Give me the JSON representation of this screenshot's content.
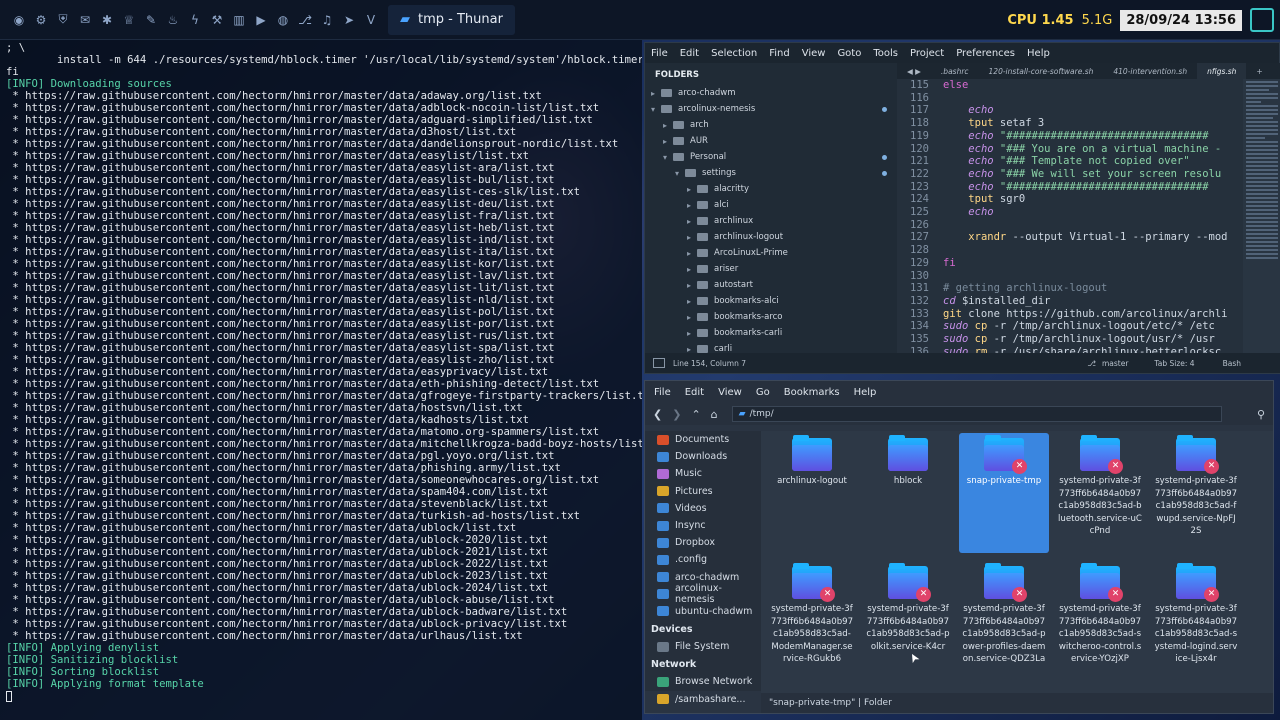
{
  "panel": {
    "window_title": "tmp - Thunar",
    "cpu": "CPU 1.45",
    "mem": "5.1G",
    "datetime": "28/09/24 13:56"
  },
  "terminal": {
    "lines": [
      {
        "t": "; \\",
        "c": ""
      },
      {
        "t": "        install -m 644 ./resources/systemd/hblock.timer '/usr/local/lib/systemd/system'/hblock.timer; \\",
        "c": ""
      },
      {
        "t": "fi",
        "c": ""
      },
      {
        "t": "[INFO] Downloading sources",
        "c": "info"
      },
      {
        "t": " * https://raw.githubusercontent.com/hectorm/hmirror/master/data/adaway.org/list.txt",
        "c": "url"
      },
      {
        "t": " * https://raw.githubusercontent.com/hectorm/hmirror/master/data/adblock-nocoin-list/list.txt",
        "c": "url"
      },
      {
        "t": " * https://raw.githubusercontent.com/hectorm/hmirror/master/data/adguard-simplified/list.txt",
        "c": "url"
      },
      {
        "t": " * https://raw.githubusercontent.com/hectorm/hmirror/master/data/d3host/list.txt",
        "c": "url"
      },
      {
        "t": " * https://raw.githubusercontent.com/hectorm/hmirror/master/data/dandelionsprout-nordic/list.txt",
        "c": "url"
      },
      {
        "t": " * https://raw.githubusercontent.com/hectorm/hmirror/master/data/easylist/list.txt",
        "c": "url"
      },
      {
        "t": " * https://raw.githubusercontent.com/hectorm/hmirror/master/data/easylist-ara/list.txt",
        "c": "url"
      },
      {
        "t": " * https://raw.githubusercontent.com/hectorm/hmirror/master/data/easylist-bul/list.txt",
        "c": "url"
      },
      {
        "t": " * https://raw.githubusercontent.com/hectorm/hmirror/master/data/easylist-ces-slk/list.txt",
        "c": "url"
      },
      {
        "t": " * https://raw.githubusercontent.com/hectorm/hmirror/master/data/easylist-deu/list.txt",
        "c": "url"
      },
      {
        "t": " * https://raw.githubusercontent.com/hectorm/hmirror/master/data/easylist-fra/list.txt",
        "c": "url"
      },
      {
        "t": " * https://raw.githubusercontent.com/hectorm/hmirror/master/data/easylist-heb/list.txt",
        "c": "url"
      },
      {
        "t": " * https://raw.githubusercontent.com/hectorm/hmirror/master/data/easylist-ind/list.txt",
        "c": "url"
      },
      {
        "t": " * https://raw.githubusercontent.com/hectorm/hmirror/master/data/easylist-ita/list.txt",
        "c": "url"
      },
      {
        "t": " * https://raw.githubusercontent.com/hectorm/hmirror/master/data/easylist-kor/list.txt",
        "c": "url"
      },
      {
        "t": " * https://raw.githubusercontent.com/hectorm/hmirror/master/data/easylist-lav/list.txt",
        "c": "url"
      },
      {
        "t": " * https://raw.githubusercontent.com/hectorm/hmirror/master/data/easylist-lit/list.txt",
        "c": "url"
      },
      {
        "t": " * https://raw.githubusercontent.com/hectorm/hmirror/master/data/easylist-nld/list.txt",
        "c": "url"
      },
      {
        "t": " * https://raw.githubusercontent.com/hectorm/hmirror/master/data/easylist-pol/list.txt",
        "c": "url"
      },
      {
        "t": " * https://raw.githubusercontent.com/hectorm/hmirror/master/data/easylist-por/list.txt",
        "c": "url"
      },
      {
        "t": " * https://raw.githubusercontent.com/hectorm/hmirror/master/data/easylist-rus/list.txt",
        "c": "url"
      },
      {
        "t": " * https://raw.githubusercontent.com/hectorm/hmirror/master/data/easylist-spa/list.txt",
        "c": "url"
      },
      {
        "t": " * https://raw.githubusercontent.com/hectorm/hmirror/master/data/easylist-zho/list.txt",
        "c": "url"
      },
      {
        "t": " * https://raw.githubusercontent.com/hectorm/hmirror/master/data/easyprivacy/list.txt",
        "c": "url"
      },
      {
        "t": " * https://raw.githubusercontent.com/hectorm/hmirror/master/data/eth-phishing-detect/list.txt",
        "c": "url"
      },
      {
        "t": " * https://raw.githubusercontent.com/hectorm/hmirror/master/data/gfrogeye-firstparty-trackers/list.txt",
        "c": "url"
      },
      {
        "t": " * https://raw.githubusercontent.com/hectorm/hmirror/master/data/hostsvn/list.txt",
        "c": "url"
      },
      {
        "t": " * https://raw.githubusercontent.com/hectorm/hmirror/master/data/kadhosts/list.txt",
        "c": "url"
      },
      {
        "t": " * https://raw.githubusercontent.com/hectorm/hmirror/master/data/matomo.org-spammers/list.txt",
        "c": "url"
      },
      {
        "t": " * https://raw.githubusercontent.com/hectorm/hmirror/master/data/mitchellkrogza-badd-boyz-hosts/list.txt",
        "c": "url"
      },
      {
        "t": " * https://raw.githubusercontent.com/hectorm/hmirror/master/data/pgl.yoyo.org/list.txt",
        "c": "url"
      },
      {
        "t": " * https://raw.githubusercontent.com/hectorm/hmirror/master/data/phishing.army/list.txt",
        "c": "url"
      },
      {
        "t": " * https://raw.githubusercontent.com/hectorm/hmirror/master/data/someonewhocares.org/list.txt",
        "c": "url"
      },
      {
        "t": " * https://raw.githubusercontent.com/hectorm/hmirror/master/data/spam404.com/list.txt",
        "c": "url"
      },
      {
        "t": " * https://raw.githubusercontent.com/hectorm/hmirror/master/data/stevenblack/list.txt",
        "c": "url"
      },
      {
        "t": " * https://raw.githubusercontent.com/hectorm/hmirror/master/data/turkish-ad-hosts/list.txt",
        "c": "url"
      },
      {
        "t": " * https://raw.githubusercontent.com/hectorm/hmirror/master/data/ublock/list.txt",
        "c": "url"
      },
      {
        "t": " * https://raw.githubusercontent.com/hectorm/hmirror/master/data/ublock-2020/list.txt",
        "c": "url"
      },
      {
        "t": " * https://raw.githubusercontent.com/hectorm/hmirror/master/data/ublock-2021/list.txt",
        "c": "url"
      },
      {
        "t": " * https://raw.githubusercontent.com/hectorm/hmirror/master/data/ublock-2022/list.txt",
        "c": "url"
      },
      {
        "t": " * https://raw.githubusercontent.com/hectorm/hmirror/master/data/ublock-2023/list.txt",
        "c": "url"
      },
      {
        "t": " * https://raw.githubusercontent.com/hectorm/hmirror/master/data/ublock-2024/list.txt",
        "c": "url"
      },
      {
        "t": " * https://raw.githubusercontent.com/hectorm/hmirror/master/data/ublock-abuse/list.txt",
        "c": "url"
      },
      {
        "t": " * https://raw.githubusercontent.com/hectorm/hmirror/master/data/ublock-badware/list.txt",
        "c": "url"
      },
      {
        "t": " * https://raw.githubusercontent.com/hectorm/hmirror/master/data/ublock-privacy/list.txt",
        "c": "url"
      },
      {
        "t": " * https://raw.githubusercontent.com/hectorm/hmirror/master/data/urlhaus/list.txt",
        "c": "url"
      },
      {
        "t": "[INFO] Applying denylist",
        "c": "info"
      },
      {
        "t": "[INFO] Sanitizing blocklist",
        "c": "info"
      },
      {
        "t": "[INFO] Sorting blocklist",
        "c": "info"
      },
      {
        "t": "[INFO] Applying format template",
        "c": "info"
      }
    ]
  },
  "editor": {
    "menu": [
      "File",
      "Edit",
      "Selection",
      "Find",
      "View",
      "Goto",
      "Tools",
      "Project",
      "Preferences",
      "Help"
    ],
    "folders_heading": "FOLDERS",
    "tree": [
      {
        "label": "arco-chadwm",
        "depth": 0,
        "chev": "▸",
        "dot": false
      },
      {
        "label": "arcolinux-nemesis",
        "depth": 0,
        "chev": "▾",
        "dot": true
      },
      {
        "label": "arch",
        "depth": 1,
        "chev": "▸",
        "dot": false
      },
      {
        "label": "AUR",
        "depth": 1,
        "chev": "▸",
        "dot": false
      },
      {
        "label": "Personal",
        "depth": 1,
        "chev": "▾",
        "dot": true
      },
      {
        "label": "settings",
        "depth": 2,
        "chev": "▾",
        "dot": true
      },
      {
        "label": "alacritty",
        "depth": 3,
        "chev": "▸",
        "dot": false
      },
      {
        "label": "alci",
        "depth": 3,
        "chev": "▸",
        "dot": false
      },
      {
        "label": "archlinux",
        "depth": 3,
        "chev": "▸",
        "dot": false
      },
      {
        "label": "archlinux-logout",
        "depth": 3,
        "chev": "▸",
        "dot": false
      },
      {
        "label": "ArcoLinuxL-Prime",
        "depth": 3,
        "chev": "▸",
        "dot": false
      },
      {
        "label": "ariser",
        "depth": 3,
        "chev": "▸",
        "dot": false
      },
      {
        "label": "autostart",
        "depth": 3,
        "chev": "▸",
        "dot": false
      },
      {
        "label": "bookmarks-alci",
        "depth": 3,
        "chev": "▸",
        "dot": false
      },
      {
        "label": "bookmarks-arco",
        "depth": 3,
        "chev": "▸",
        "dot": false
      },
      {
        "label": "bookmarks-carli",
        "depth": 3,
        "chev": "▸",
        "dot": false
      },
      {
        "label": "carli",
        "depth": 3,
        "chev": "▸",
        "dot": false
      }
    ],
    "tabs": [
      ".bashrc",
      "120-install-core-software.sh",
      "410-intervention.sh",
      "nfigs.sh"
    ],
    "code": [
      {
        "n": "115",
        "h": "<span class='kw'>else</span>"
      },
      {
        "n": "116",
        "h": ""
      },
      {
        "n": "117",
        "h": "    <span class='ec'>echo</span>"
      },
      {
        "n": "118",
        "h": "    <span class='cmd'>tput</span> setaf 3"
      },
      {
        "n": "119",
        "h": "    <span class='ec'>echo</span> <span class='str'>\"################################</span>"
      },
      {
        "n": "120",
        "h": "    <span class='ec'>echo</span> <span class='str'>\"### You are on a virtual machine -</span>"
      },
      {
        "n": "121",
        "h": "    <span class='ec'>echo</span> <span class='str'>\"### Template not copied over\"</span>"
      },
      {
        "n": "122",
        "h": "    <span class='ec'>echo</span> <span class='str'>\"### We will set your screen resolu</span>"
      },
      {
        "n": "123",
        "h": "    <span class='ec'>echo</span> <span class='str'>\"################################</span>"
      },
      {
        "n": "124",
        "h": "    <span class='cmd'>tput</span> sgr0"
      },
      {
        "n": "125",
        "h": "    <span class='ec'>echo</span>"
      },
      {
        "n": "126",
        "h": ""
      },
      {
        "n": "127",
        "h": "    <span class='cmd'>xrandr</span> --output Virtual-1 --primary --mod"
      },
      {
        "n": "128",
        "h": ""
      },
      {
        "n": "129",
        "h": "<span class='kw'>fi</span>"
      },
      {
        "n": "130",
        "h": ""
      },
      {
        "n": "131",
        "h": "<span class='cmt'># getting archlinux-logout</span>"
      },
      {
        "n": "132",
        "h": "<span class='ec'>cd</span> $installed_dir"
      },
      {
        "n": "133",
        "h": "<span class='cmd'>git</span> clone https://github.com/arcolinux/archli"
      },
      {
        "n": "134",
        "h": "<span class='ec'>sudo</span> <span class='cmd'>cp</span> -r /tmp/archlinux-logout/etc/* /etc"
      },
      {
        "n": "135",
        "h": "<span class='ec'>sudo</span> <span class='cmd'>cp</span> -r /tmp/archlinux-logout/usr/* /usr"
      },
      {
        "n": "136",
        "h": "<span class='ec'>sudo</span> <span class='cmd'>rm</span> -r /usr/share/archlinux-betterlocksc"
      }
    ],
    "status": {
      "position": "Line 154, Column 7",
      "branch": "master",
      "tab_size": "Tab Size: 4",
      "syntax": "Bash"
    }
  },
  "thunar": {
    "menu": [
      "File",
      "Edit",
      "View",
      "Go",
      "Bookmarks",
      "Help"
    ],
    "location": "/tmp/",
    "places": [
      "Documents",
      "Downloads",
      "Music",
      "Pictures",
      "Videos",
      "Insync",
      "Dropbox",
      ".config",
      "arco-chadwm",
      "arcolinux-nemesis",
      "ubuntu-chadwm"
    ],
    "devices_heading": "Devices",
    "devices": [
      "File System"
    ],
    "network_heading": "Network",
    "network": [
      "Browse Network",
      "/sambashare..."
    ],
    "items": [
      {
        "name": "archlinux-logout",
        "locked": false,
        "selected": false
      },
      {
        "name": "hblock",
        "locked": false,
        "selected": false
      },
      {
        "name": "snap-private-tmp",
        "locked": true,
        "selected": true
      },
      {
        "name": "systemd-private-3f773ff6b6484a0b97c1ab958d83c5ad-bluetooth.service-uCcPnd",
        "locked": true,
        "selected": false
      },
      {
        "name": "systemd-private-3f773ff6b6484a0b97c1ab958d83c5ad-fwupd.service-NpFJ2S",
        "locked": true,
        "selected": false
      },
      {
        "name": "systemd-private-3f773ff6b6484a0b97c1ab958d83c5ad-ModemManager.service-RGukb6",
        "locked": true,
        "selected": false
      },
      {
        "name": "systemd-private-3f773ff6b6484a0b97c1ab958d83c5ad-polkit.service-K4cr",
        "locked": true,
        "selected": false
      },
      {
        "name": "systemd-private-3f773ff6b6484a0b97c1ab958d83c5ad-power-profiles-daemon.service-QDZ3La",
        "locked": true,
        "selected": false
      },
      {
        "name": "systemd-private-3f773ff6b6484a0b97c1ab958d83c5ad-switcheroo-control.service-YOzjXP",
        "locked": true,
        "selected": false
      },
      {
        "name": "systemd-private-3f773ff6b6484a0b97c1ab958d83c5ad-systemd-logind.service-Ljsx4r",
        "locked": true,
        "selected": false
      }
    ],
    "status": "\"snap-private-tmp\"  |  Folder"
  }
}
